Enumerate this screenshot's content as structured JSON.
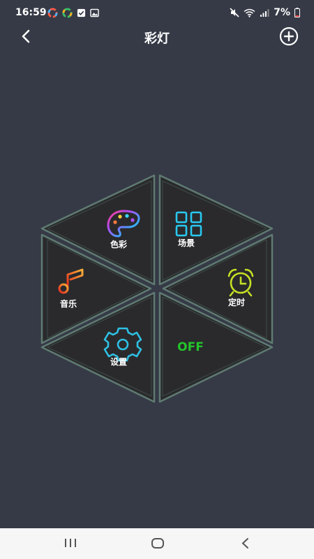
{
  "status_bar": {
    "time": "16:59",
    "battery_percent": "7%",
    "icons_left": [
      "app-icon-1",
      "app-icon-2",
      "checkbox-notification-icon",
      "image-notification-icon"
    ],
    "icons_right": [
      "mute-icon",
      "wifi-icon",
      "signal-icon",
      "battery-icon"
    ]
  },
  "header": {
    "title": "彩灯",
    "back_icon": "chevron-left-icon",
    "add_icon": "plus-circle-icon"
  },
  "menu": {
    "color_label": "色彩",
    "scene_label": "场景",
    "music_label": "音乐",
    "timer_label": "定时",
    "settings_label": "设置",
    "off_label": "OFF"
  },
  "colors": {
    "background": "#363a46",
    "segment_fill": "#2a2a2c",
    "segment_border": "#5f7a72",
    "off_green": "#22c52a"
  },
  "nav_bar": {
    "icons": [
      "recent-apps-icon",
      "home-icon",
      "back-icon"
    ]
  }
}
